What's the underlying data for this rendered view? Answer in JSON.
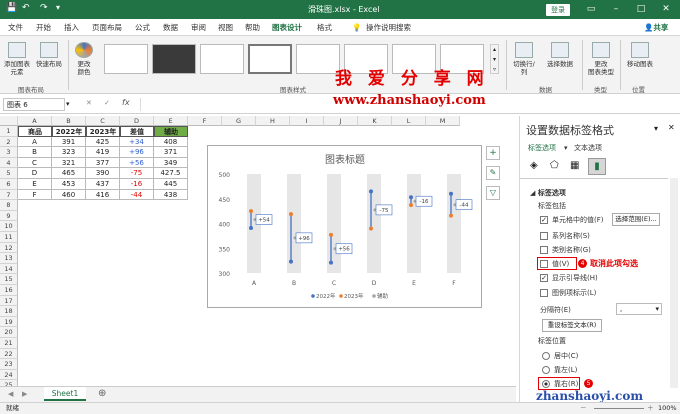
{
  "window": {
    "title": "滑珠图.xlsx  -  Excel",
    "login_label": "登录",
    "share_label": "共享"
  },
  "colors": {
    "accent": "#217346",
    "blue": "#4472c4",
    "orange": "#ed7d31",
    "gray_band": "#e7e6e6",
    "red_annot": "#e40000"
  },
  "tabs": [
    "文件",
    "开始",
    "插入",
    "页面布局",
    "公式",
    "数据",
    "审阅",
    "视图",
    "帮助",
    "图表设计",
    "格式"
  ],
  "active_tab": "图表设计",
  "tell_me": "操作说明搜索",
  "ribbon": {
    "add_element": "添加图表\n元素",
    "quick_layout": "快速布局",
    "change_colors": "更改\n颜色",
    "group_layout": "图表布局",
    "group_styles": "图表样式",
    "switch_rowcol": "切换行/列",
    "select_data": "选择数据",
    "group_data": "数据",
    "change_type": "更改\n图表类型",
    "group_type": "类型",
    "move_chart": "移动图表",
    "group_location": "位置"
  },
  "watermark": {
    "line1": "我 爱 分 享 网",
    "line2": "www.zhanshaoyi.com",
    "bottom": "zhanshaoyi.com"
  },
  "formula_bar": {
    "name_box": "图表 6",
    "fx": "fx",
    "cancel": "✕",
    "enter": "✓"
  },
  "columns": [
    "A",
    "B",
    "C",
    "D",
    "E",
    "F",
    "G",
    "H",
    "I",
    "J",
    "K",
    "L",
    "M"
  ],
  "rows": [
    "1",
    "2",
    "3",
    "4",
    "5",
    "6",
    "7",
    "8",
    "9",
    "10",
    "11",
    "12",
    "13",
    "14",
    "15",
    "16",
    "17",
    "18",
    "19",
    "20",
    "21",
    "22",
    "23",
    "24",
    "25"
  ],
  "table": {
    "headers": [
      "商品",
      "2022年",
      "2023年",
      "差值",
      "辅助"
    ],
    "rows": [
      [
        "A",
        "391",
        "425",
        "+34",
        "408"
      ],
      [
        "B",
        "323",
        "419",
        "+96",
        "371"
      ],
      [
        "C",
        "321",
        "377",
        "+56",
        "349"
      ],
      [
        "D",
        "465",
        "390",
        "-75",
        "427.5"
      ],
      [
        "E",
        "453",
        "437",
        "-16",
        "445"
      ],
      [
        "F",
        "460",
        "416",
        "-44",
        "438"
      ]
    ]
  },
  "chart_data": {
    "type": "scatter",
    "title": "图表标题",
    "categories": [
      "A",
      "B",
      "C",
      "D",
      "E",
      "F"
    ],
    "ylim": [
      300,
      500
    ],
    "yticks": [
      "500",
      "450",
      "400",
      "350",
      "300"
    ],
    "legend_position": "bottom",
    "series": [
      {
        "name": "2022年",
        "values": [
          391,
          323,
          321,
          465,
          453,
          460
        ],
        "color": "#4472c4"
      },
      {
        "name": "2023年",
        "values": [
          425,
          419,
          377,
          390,
          437,
          416
        ],
        "color": "#ed7d31"
      },
      {
        "name": "辅助",
        "values": [
          408,
          371,
          349,
          427.5,
          445,
          438
        ],
        "color": "#a5a5a5"
      }
    ],
    "data_labels": [
      "+54",
      "+96",
      "+56",
      "-75",
      "-16",
      "-44"
    ]
  },
  "pane": {
    "title": "设置数据标签格式",
    "tab_label_options": "标签选项",
    "tab_text_options": "文本选项",
    "section_title": "标签选项",
    "contains": "标签包括",
    "opt_cell_value": "单元格中的值(F)",
    "select_range": "选择范围(E)...",
    "opt_series_name": "系列名称(S)",
    "opt_category_name": "类别名称(G)",
    "opt_value": "值(V)",
    "opt_leader": "显示引导线(H)",
    "opt_legend_key": "图例项标示(L)",
    "separator_label": "分隔符(E)",
    "separator_value": ",",
    "reset_btn": "重设标签文本(R)",
    "position_label": "标签位置",
    "pos_center": "居中(C)",
    "pos_left": "靠左(L)",
    "pos_right": "靠右(R)",
    "annot_value": "取消此项勾选",
    "annot4": "4",
    "annot5": "5"
  },
  "sheet_tab": "Sheet1",
  "status": {
    "ready": "就绪",
    "zoom": "100%"
  }
}
